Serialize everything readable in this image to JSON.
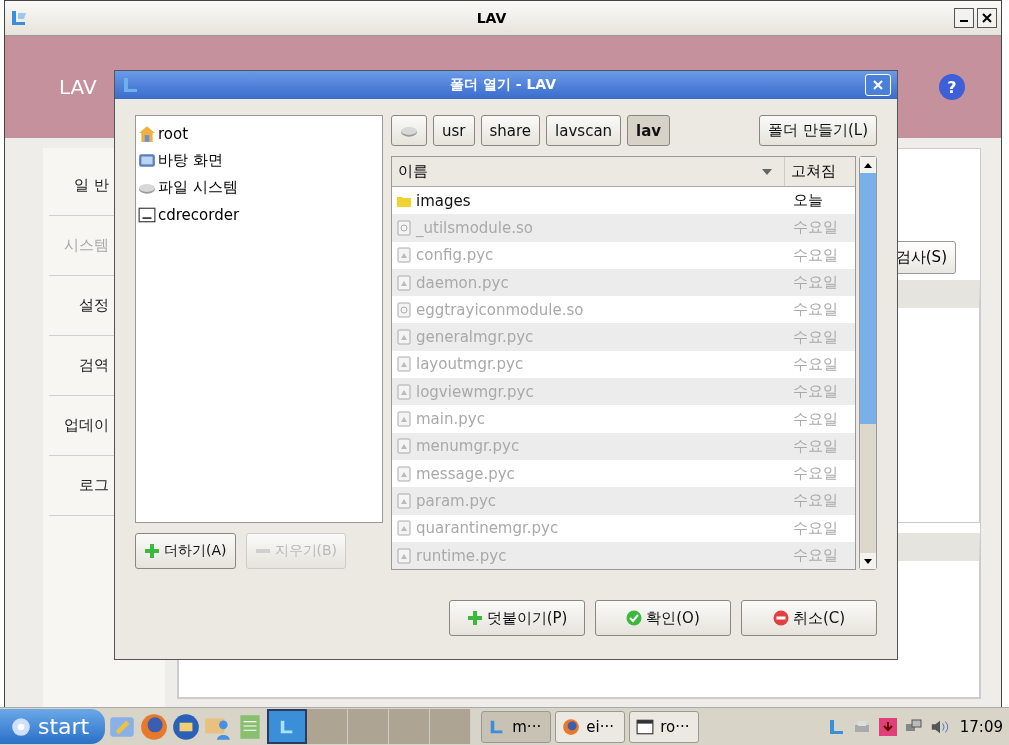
{
  "window": {
    "title": "LAV"
  },
  "header": {
    "title": "LAV",
    "help": "?"
  },
  "sidebar": {
    "items": [
      {
        "label": "일 반",
        "disabled": false
      },
      {
        "label": "시스템",
        "disabled": true
      },
      {
        "label": "설정",
        "disabled": false
      },
      {
        "label": "검역",
        "disabled": false
      },
      {
        "label": "업데이",
        "disabled": false
      },
      {
        "label": "로그",
        "disabled": false
      }
    ]
  },
  "scan_button": {
    "label": "검사(S)"
  },
  "dialog": {
    "title": "폴더 열기 - LAV",
    "places": [
      {
        "kind": "home",
        "label": "root"
      },
      {
        "kind": "desktop",
        "label": "바탕 화면"
      },
      {
        "kind": "drive",
        "label": "파일 시스템"
      },
      {
        "kind": "cdrom",
        "label": "cdrecorder"
      }
    ],
    "add_button": {
      "label": "더하기(A)",
      "disabled": false
    },
    "remove_button": {
      "label": "지우기(B)",
      "disabled": true
    },
    "path": [
      {
        "kind": "drive",
        "selected": false
      },
      {
        "kind": "folder",
        "label": "usr",
        "selected": false
      },
      {
        "kind": "folder",
        "label": "share",
        "selected": false
      },
      {
        "kind": "folder",
        "label": "lavscan",
        "selected": false
      },
      {
        "kind": "folder",
        "label": "lav",
        "selected": true
      }
    ],
    "new_folder_button": "폴더 만들기(L)",
    "columns": [
      "이름",
      "고쳐짐"
    ],
    "files": [
      {
        "kind": "folder",
        "name": "images",
        "modified": "오늘",
        "disabled": false
      },
      {
        "kind": "lib",
        "name": "_utilsmodule.so",
        "modified": "수요일",
        "disabled": true
      },
      {
        "kind": "file",
        "name": "config.pyc",
        "modified": "수요일",
        "disabled": true
      },
      {
        "kind": "file",
        "name": "daemon.pyc",
        "modified": "수요일",
        "disabled": true
      },
      {
        "kind": "lib",
        "name": "eggtrayiconmodule.so",
        "modified": "수요일",
        "disabled": true
      },
      {
        "kind": "file",
        "name": "generalmgr.pyc",
        "modified": "수요일",
        "disabled": true
      },
      {
        "kind": "file",
        "name": "layoutmgr.pyc",
        "modified": "수요일",
        "disabled": true
      },
      {
        "kind": "file",
        "name": "logviewmgr.pyc",
        "modified": "수요일",
        "disabled": true
      },
      {
        "kind": "file",
        "name": "main.pyc",
        "modified": "수요일",
        "disabled": true
      },
      {
        "kind": "file",
        "name": "menumgr.pyc",
        "modified": "수요일",
        "disabled": true
      },
      {
        "kind": "file",
        "name": "message.pyc",
        "modified": "수요일",
        "disabled": true
      },
      {
        "kind": "file",
        "name": "param.pyc",
        "modified": "수요일",
        "disabled": true
      },
      {
        "kind": "file",
        "name": "quarantinemgr.pyc",
        "modified": "수요일",
        "disabled": true
      },
      {
        "kind": "file",
        "name": "runtime.pyc",
        "modified": "수요일",
        "disabled": true
      }
    ],
    "buttons": [
      {
        "kind": "append",
        "label": "덧붙이기(P)"
      },
      {
        "kind": "ok",
        "label": "확인(O)"
      },
      {
        "kind": "cancel",
        "label": "취소(C)"
      }
    ]
  },
  "taskbar": {
    "start": "start",
    "tasks": [
      {
        "kind": "app",
        "label": "m···",
        "selected": true
      },
      {
        "kind": "browser",
        "label": "ei···",
        "selected": false
      },
      {
        "kind": "window",
        "label": "ro···",
        "selected": false
      }
    ],
    "clock": "17:09"
  }
}
